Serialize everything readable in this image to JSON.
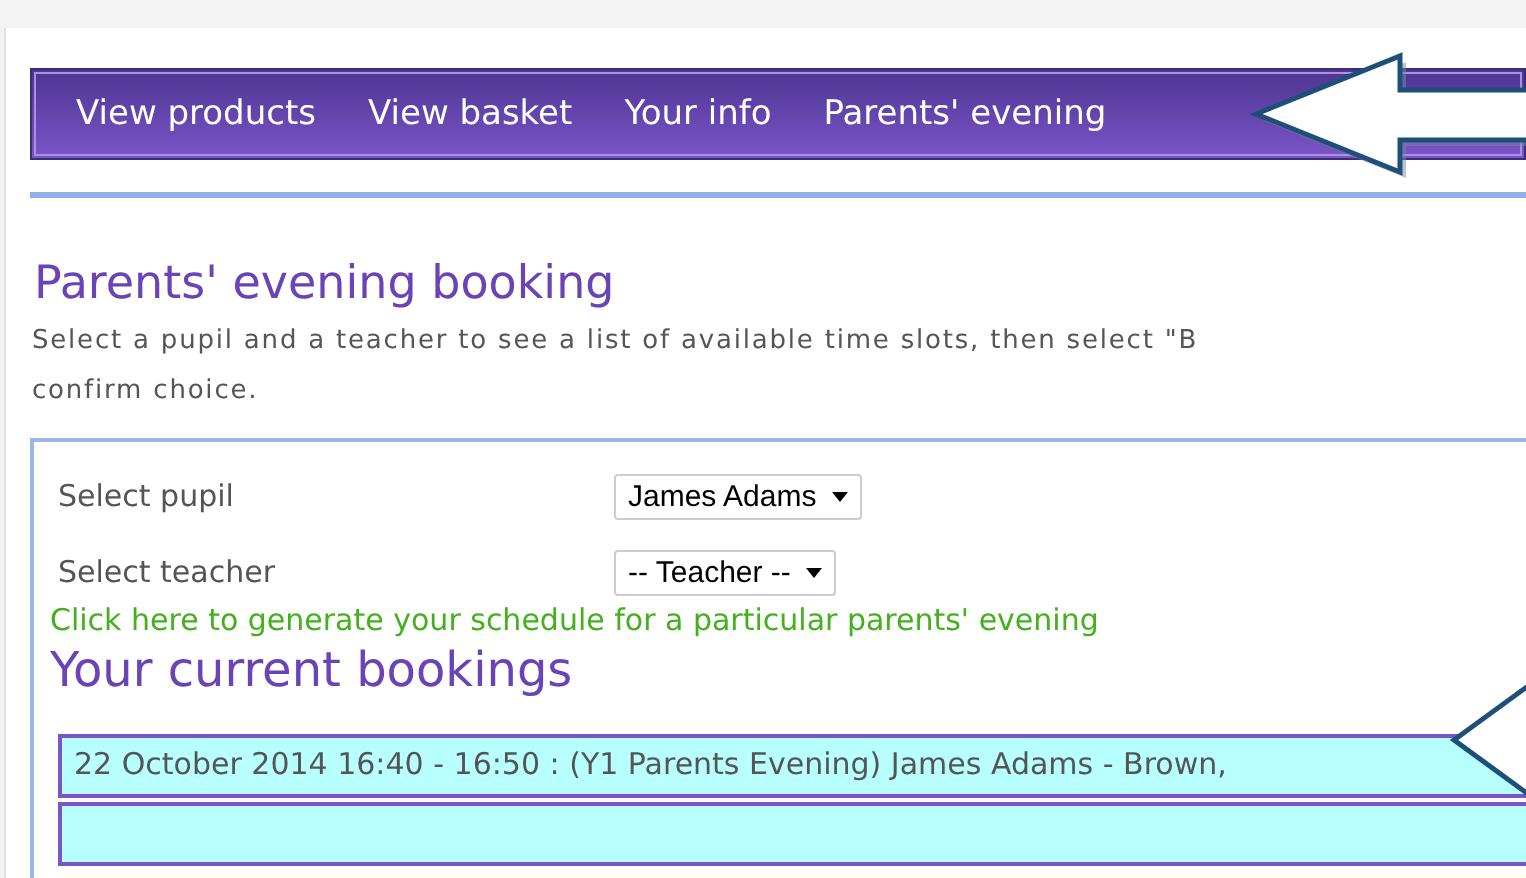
{
  "nav": {
    "items": [
      {
        "label": "View products"
      },
      {
        "label": "View basket"
      },
      {
        "label": "Your info"
      },
      {
        "label": "Parents' evening"
      }
    ]
  },
  "page": {
    "title": "Parents' evening booking",
    "description": "Select a pupil and a teacher to see a list of available time slots, then select \"B",
    "description_line_2": "confirm choice."
  },
  "form": {
    "fields": [
      {
        "label": "Select pupil",
        "value": "James Adams"
      },
      {
        "label": "Select teacher",
        "value": "-- Teacher --"
      }
    ],
    "schedule_link": "Click here to generate your schedule for a particular parents' evening",
    "bookings_title": "Your current bookings",
    "bookings": [
      {
        "text": "22 October 2014 16:40 - 16:50 : (Y1 Parents Evening) James Adams - Brown,"
      }
    ]
  },
  "annotations": [
    {
      "kind": "arrow"
    },
    {
      "kind": "arrow"
    }
  ]
}
